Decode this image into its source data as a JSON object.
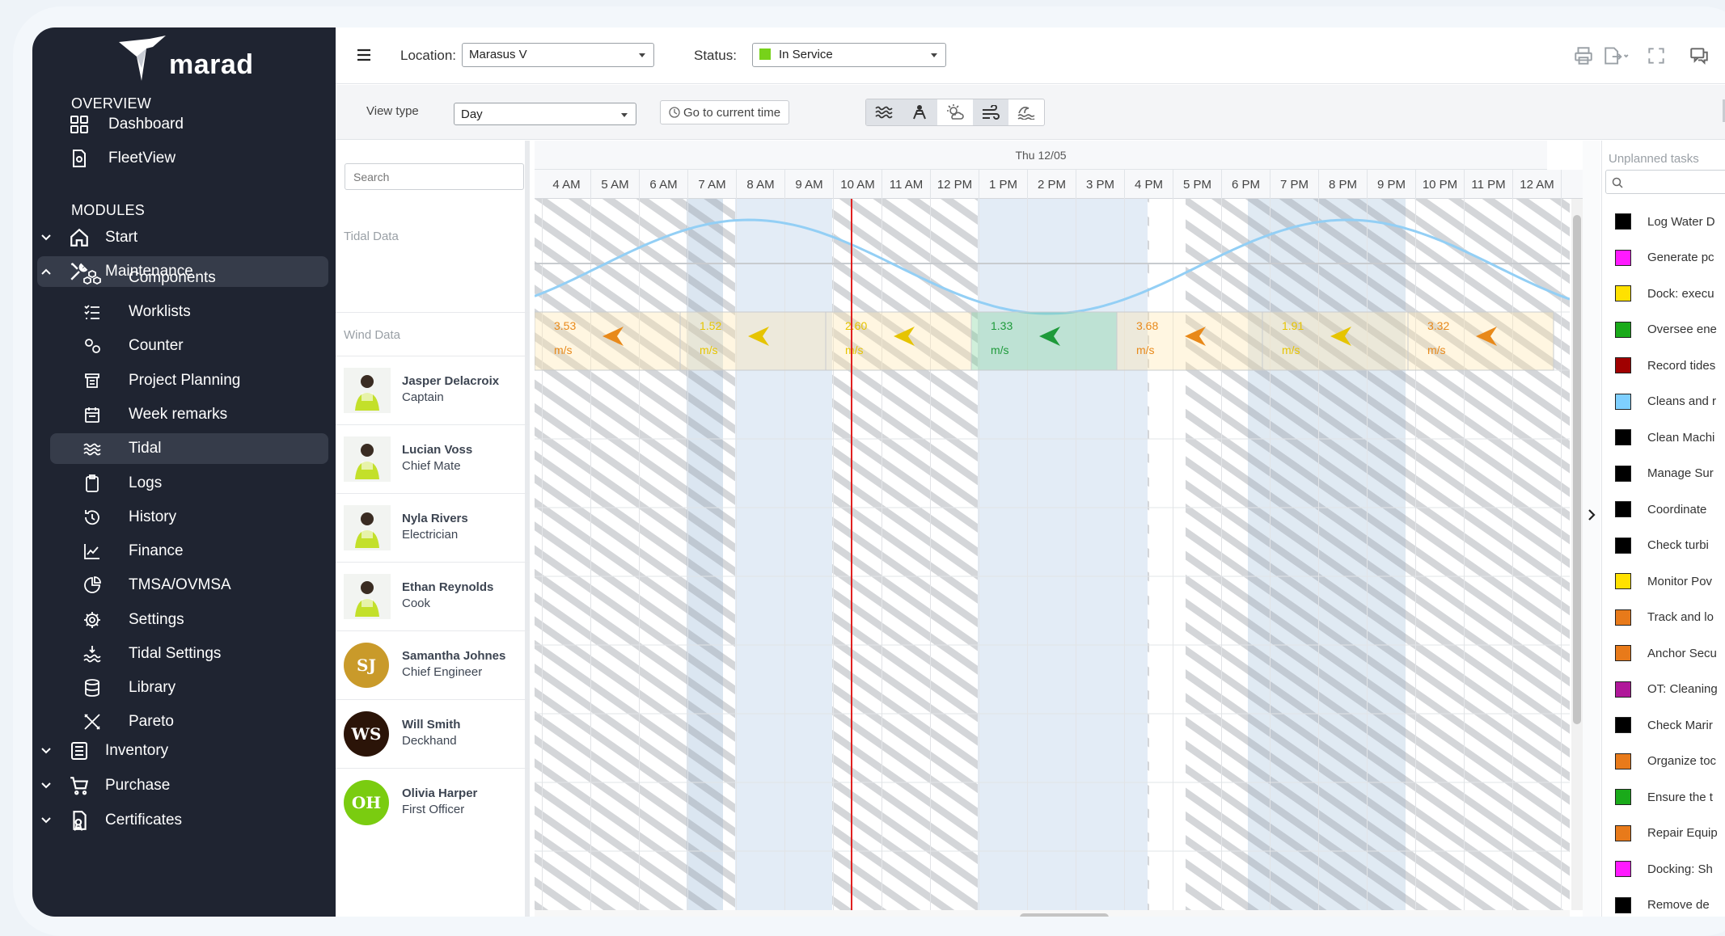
{
  "brand": {
    "name": "marad"
  },
  "sidebar": {
    "overview_header": "OVERVIEW",
    "modules_header": "MODULES",
    "overview": [
      {
        "label": "Dashboard",
        "icon": "dashboard-icon"
      },
      {
        "label": "FleetView",
        "icon": "fleetview-icon"
      }
    ],
    "modules": [
      {
        "label": "Start",
        "icon": "home-icon"
      },
      {
        "label": "Maintenance",
        "icon": "tools-icon"
      }
    ],
    "maintenance_children": [
      {
        "label": "Components",
        "icon": "components-icon"
      },
      {
        "label": "Worklists",
        "icon": "worklists-icon"
      },
      {
        "label": "Counter",
        "icon": "counter-icon"
      },
      {
        "label": "Project Planning",
        "icon": "project-planning-icon"
      },
      {
        "label": "Week remarks",
        "icon": "calendar-icon"
      },
      {
        "label": "Tidal",
        "icon": "tidal-icon"
      },
      {
        "label": "Logs",
        "icon": "clipboard-icon"
      },
      {
        "label": "History",
        "icon": "history-icon"
      },
      {
        "label": "Finance",
        "icon": "chart-icon"
      },
      {
        "label": "TMSA/OVMSA",
        "icon": "pie-icon"
      },
      {
        "label": "Settings",
        "icon": "gear-icon"
      },
      {
        "label": "Tidal Settings",
        "icon": "tidal-settings-icon"
      },
      {
        "label": "Library",
        "icon": "database-icon"
      },
      {
        "label": "Pareto",
        "icon": "pareto-icon"
      }
    ],
    "bottom_modules": [
      {
        "label": "Inventory",
        "icon": "inventory-icon"
      },
      {
        "label": "Purchase",
        "icon": "cart-icon"
      },
      {
        "label": "Certificates",
        "icon": "certificate-icon"
      }
    ]
  },
  "topbar": {
    "location_label": "Location:",
    "location_value": "Marasus V",
    "status_label": "Status:",
    "status_value": "In Service",
    "status_color": "#77d21a"
  },
  "toolbar": {
    "view_type_label": "View type",
    "view_type_value": "Day",
    "go_current_label": "Go to current time"
  },
  "resources": {
    "search_placeholder": "Search",
    "tidal_label": "Tidal Data",
    "wind_label": "Wind Data",
    "people": [
      {
        "name": "Jasper Delacroix",
        "role": "Captain",
        "initials": "",
        "color": "#ffffff"
      },
      {
        "name": "Lucian Voss",
        "role": "Chief Mate",
        "initials": "",
        "color": "#ffffff"
      },
      {
        "name": "Nyla Rivers",
        "role": "Electrician",
        "initials": "",
        "color": "#ffffff"
      },
      {
        "name": "Ethan Reynolds",
        "role": "Cook",
        "initials": "",
        "color": "#ffffff"
      },
      {
        "name": "Samantha Johnes",
        "role": "Chief Engineer",
        "initials": "SJ",
        "color": "#c99a2a"
      },
      {
        "name": "Will Smith",
        "role": "Deckhand",
        "initials": "WS",
        "color": "#2b1408"
      },
      {
        "name": "Olivia Harper",
        "role": "First Officer",
        "initials": "OH",
        "color": "#7acc10"
      }
    ]
  },
  "timeline": {
    "date_label": "Thu 12/05",
    "hours": [
      "4 AM",
      "5 AM",
      "6 AM",
      "7 AM",
      "8 AM",
      "9 AM",
      "10 AM",
      "11 AM",
      "12 PM",
      "1 PM",
      "2 PM",
      "3 PM",
      "4 PM",
      "5 PM",
      "6 PM",
      "7 PM",
      "8 PM",
      "9 PM",
      "10 PM",
      "11 PM",
      "12 AM"
    ],
    "wind": [
      {
        "value": "3.53",
        "unit": "m/s",
        "color": "#e8891a"
      },
      {
        "value": "1.52",
        "unit": "m/s",
        "color": "#e6c400"
      },
      {
        "value": "2.60",
        "unit": "m/s",
        "color": "#e6c400"
      },
      {
        "value": "1.33",
        "unit": "m/s",
        "color": "#1e9a3a"
      },
      {
        "value": "3.68",
        "unit": "m/s",
        "color": "#e8891a"
      },
      {
        "value": "1.91",
        "unit": "m/s",
        "color": "#e6c400"
      },
      {
        "value": "3.32",
        "unit": "m/s",
        "color": "#e8891a"
      }
    ]
  },
  "unplanned": {
    "title": "Unplanned tasks",
    "tasks": [
      {
        "label": "Log Water D",
        "color": "#000000"
      },
      {
        "label": "Generate pc",
        "color": "#ff1aff"
      },
      {
        "label": "Dock: execu",
        "color": "#ffe100"
      },
      {
        "label": "Oversee ene",
        "color": "#1aaa1a"
      },
      {
        "label": "Record tides",
        "color": "#a00000"
      },
      {
        "label": "Cleans and r",
        "color": "#7ecfff"
      },
      {
        "label": "Clean Machi",
        "color": "#000000"
      },
      {
        "label": "Manage Sur",
        "color": "#000000"
      },
      {
        "label": "Coordinate",
        "color": "#000000"
      },
      {
        "label": "Check turbi",
        "color": "#000000"
      },
      {
        "label": "Monitor Pov",
        "color": "#ffe100"
      },
      {
        "label": "Track and lo",
        "color": "#e87a1a"
      },
      {
        "label": "Anchor Secu",
        "color": "#e87a1a"
      },
      {
        "label": "OT: Cleaning",
        "color": "#b0189a"
      },
      {
        "label": "Check Marir",
        "color": "#000000"
      },
      {
        "label": "Organize toc",
        "color": "#e87a1a"
      },
      {
        "label": "Ensure the t",
        "color": "#1aaa1a"
      },
      {
        "label": "Repair Equip",
        "color": "#e87a1a"
      },
      {
        "label": "Docking: Sh",
        "color": "#ff1aff"
      },
      {
        "label": "Remove de",
        "color": "#000000"
      }
    ]
  }
}
